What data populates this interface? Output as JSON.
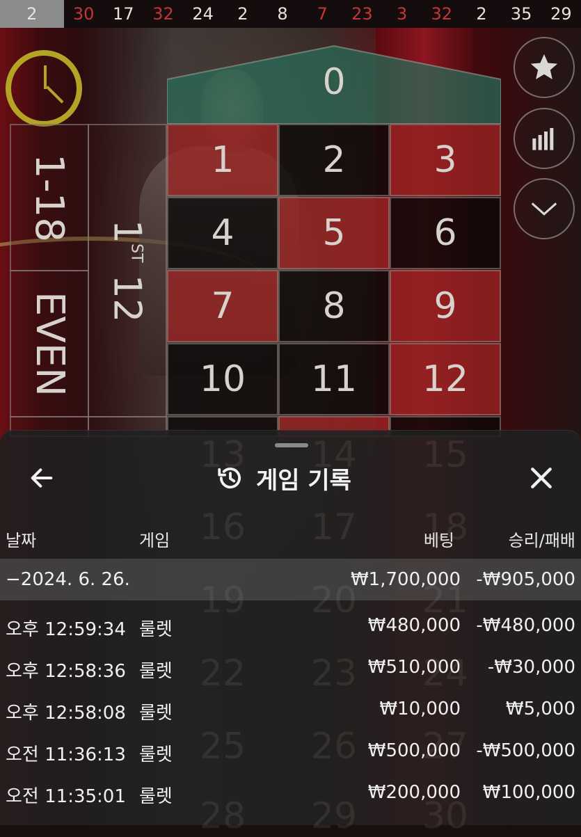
{
  "history": {
    "current": "2",
    "numbers": [
      {
        "value": "30",
        "color": "red"
      },
      {
        "value": "17",
        "color": "black"
      },
      {
        "value": "32",
        "color": "red"
      },
      {
        "value": "24",
        "color": "black"
      },
      {
        "value": "2",
        "color": "black"
      },
      {
        "value": "8",
        "color": "black"
      },
      {
        "value": "7",
        "color": "red"
      },
      {
        "value": "23",
        "color": "red"
      },
      {
        "value": "3",
        "color": "red"
      },
      {
        "value": "32",
        "color": "red"
      },
      {
        "value": "2",
        "color": "black"
      },
      {
        "value": "35",
        "color": "black"
      },
      {
        "value": "29",
        "color": "black"
      }
    ]
  },
  "side_buttons": {
    "favorite_icon": "star-icon",
    "stats_icon": "bar-chart-icon",
    "collapse_icon": "chevron-down-icon"
  },
  "board": {
    "zero": "0",
    "numbers": [
      {
        "value": "1",
        "color": "red"
      },
      {
        "value": "2",
        "color": "black"
      },
      {
        "value": "3",
        "color": "red"
      },
      {
        "value": "4",
        "color": "black"
      },
      {
        "value": "5",
        "color": "red"
      },
      {
        "value": "6",
        "color": "black"
      },
      {
        "value": "7",
        "color": "red"
      },
      {
        "value": "8",
        "color": "black"
      },
      {
        "value": "9",
        "color": "red"
      },
      {
        "value": "10",
        "color": "black"
      },
      {
        "value": "11",
        "color": "black"
      },
      {
        "value": "12",
        "color": "red"
      }
    ],
    "ghost_numbers": [
      "13",
      "14",
      "15",
      "16",
      "17",
      "18",
      "19",
      "20",
      "21",
      "22",
      "23",
      "24",
      "25",
      "26",
      "27",
      "28",
      "29",
      "30"
    ],
    "low_bet": "1-18",
    "even_bet": "EVEN",
    "dozen_main": "1",
    "dozen_sup": "ST",
    "dozen_tail": " 12"
  },
  "sheet": {
    "title": "게임 기록",
    "back_icon": "arrow-left-icon",
    "history_icon": "history-icon",
    "close_icon": "close-icon",
    "columns": {
      "date": "날짜",
      "game": "게임",
      "bet": "베팅",
      "win_loss": "승리/패배"
    },
    "date_group": {
      "date": "−2024. 6. 26.",
      "bet": "₩1,700,000",
      "win_loss": "-₩905,000"
    },
    "rows": [
      {
        "time": "오후 12:59:34",
        "game": "룰렛",
        "bet": "₩480,000",
        "win_loss": "-₩480,000"
      },
      {
        "time": "오후 12:58:36",
        "game": "룰렛",
        "bet": "₩510,000",
        "win_loss": "-₩30,000"
      },
      {
        "time": "오후 12:58:08",
        "game": "룰렛",
        "bet": "₩10,000",
        "win_loss": "₩5,000"
      },
      {
        "time": "오전 11:36:13",
        "game": "룰렛",
        "bet": "₩500,000",
        "win_loss": "-₩500,000"
      },
      {
        "time": "오전 11:35:01",
        "game": "룰렛",
        "bet": "₩200,000",
        "win_loss": "₩100,000"
      }
    ]
  }
}
